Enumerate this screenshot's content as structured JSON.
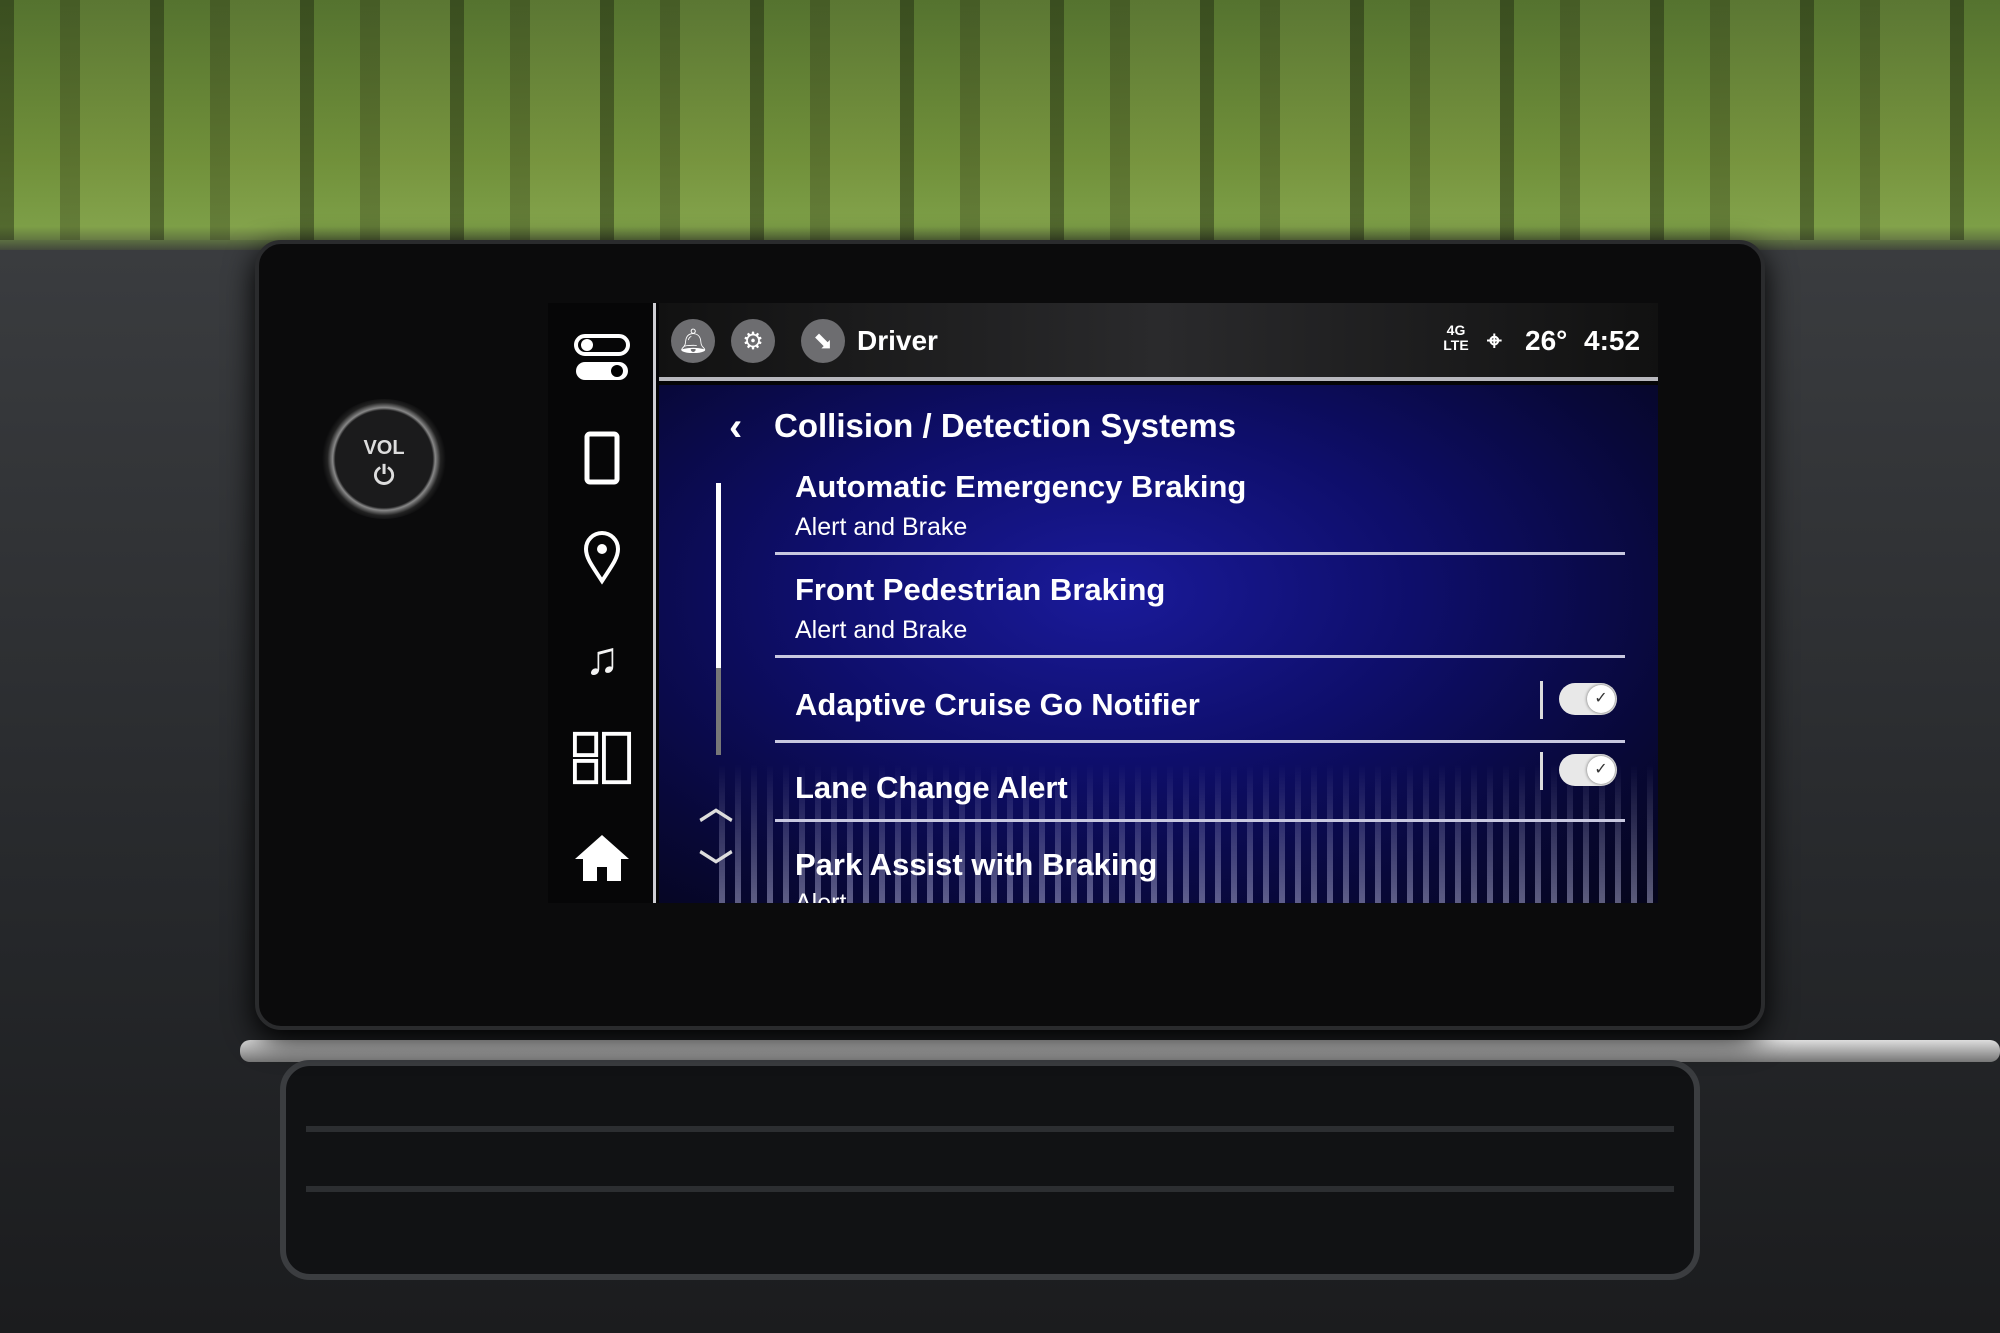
{
  "header": {
    "profile": "Driver",
    "network": "4G LTE",
    "temperature": "26°",
    "time": "4:52"
  },
  "hardware": {
    "vol_label": "VOL"
  },
  "sidebar": {
    "items": [
      {
        "icon": "toggles-icon"
      },
      {
        "icon": "phone-icon"
      },
      {
        "icon": "location-pin-icon"
      },
      {
        "icon": "music-note-icon"
      },
      {
        "icon": "apps-grid-icon"
      },
      {
        "icon": "home-icon"
      }
    ]
  },
  "page": {
    "title": "Collision / Detection Systems"
  },
  "settings": [
    {
      "title": "Automatic Emergency Braking",
      "subtitle": "Alert and Brake"
    },
    {
      "title": "Front Pedestrian Braking",
      "subtitle": "Alert and Brake"
    },
    {
      "title": "Adaptive Cruise Go Notifier",
      "toggle": true
    },
    {
      "title": "Lane Change Alert",
      "toggle": true
    },
    {
      "title": "Park Assist with Braking",
      "subtitle": "Alert"
    }
  ],
  "colors": {
    "accent": "#1a1a9a",
    "text": "#ffffff"
  }
}
